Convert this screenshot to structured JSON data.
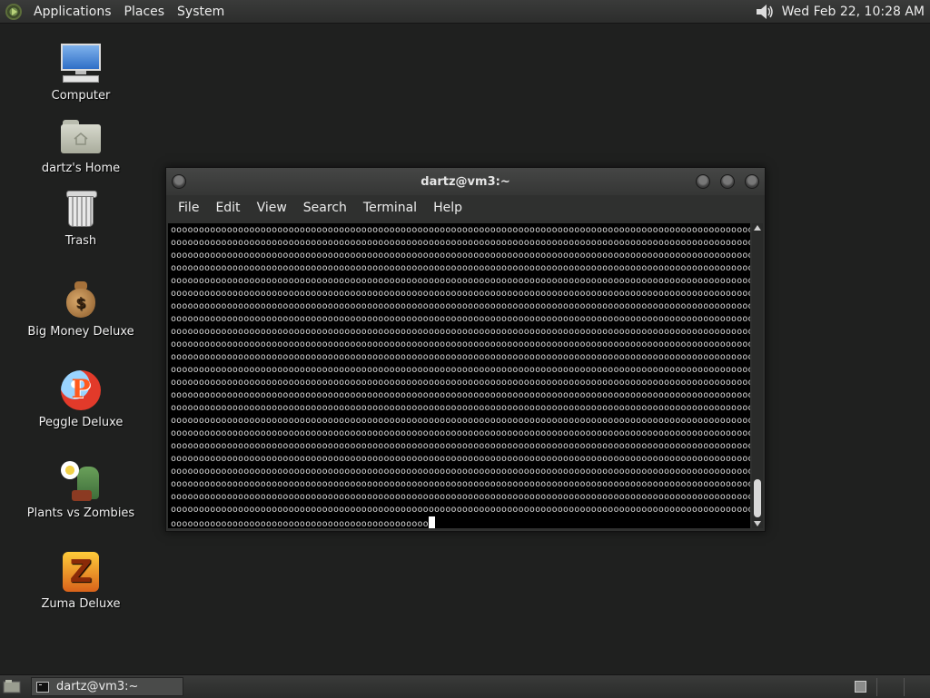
{
  "top_panel": {
    "menus": [
      "Applications",
      "Places",
      "System"
    ],
    "clock": "Wed Feb 22, 10:28 AM",
    "volume_icon": "speaker-icon"
  },
  "desktop_icons": [
    {
      "label": "Computer",
      "icon": "computer-icon"
    },
    {
      "label": "dartz's Home",
      "icon": "home-folder-icon"
    },
    {
      "label": "Trash",
      "icon": "trash-icon"
    },
    {
      "label": "Big Money Deluxe",
      "icon": "money-bag-icon"
    },
    {
      "label": "Peggle Deluxe",
      "icon": "peggle-icon"
    },
    {
      "label": "Plants vs Zombies",
      "icon": "plants-vs-zombies-icon"
    },
    {
      "label": "Zuma Deluxe",
      "icon": "zuma-icon"
    }
  ],
  "terminal": {
    "title": "dartz@vm3:~",
    "menus": [
      "File",
      "Edit",
      "View",
      "Search",
      "Terminal",
      "Help"
    ],
    "line_text": "oooooooooooooooooooooooooooooooooooooooooooooooooooooooooooooooooooooooooooooooooooooooooooooooooooooooooooooooooooooooooo",
    "full_line_count": 23,
    "last_line_text": "oooooooooooooooooooooooooooooooooooooooooooooo"
  },
  "bottom_panel": {
    "task_label": "dartz@vm3:~"
  }
}
